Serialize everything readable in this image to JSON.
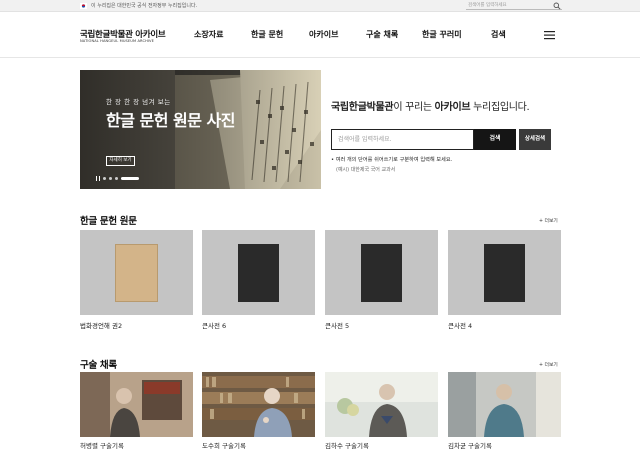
{
  "gov": {
    "notice": "이 누리집은 대한민국 공식 전자정부 누리집입니다.",
    "search_placeholder": "검색어를 입력하세요"
  },
  "header": {
    "logo_title": "국립한글박물관 아카이브",
    "logo_sub": "NATIONAL HANGEUL MUSEUM ARCHIVE",
    "nav": [
      "소장자료",
      "한글 문헌",
      "아카이브",
      "구술 채록",
      "한글 꾸러미",
      "검색"
    ]
  },
  "hero": {
    "subtitle": "한 장 한 장 넘겨 보는",
    "title": "한글 문헌 원문 사진",
    "button": "자세히 보기",
    "slide_count": 4,
    "active_slide": 4
  },
  "search": {
    "intro_a": "국립한글박물관",
    "intro_b": "이 꾸리는 ",
    "intro_c": "아카이브",
    "intro_d": " 누리집입니다.",
    "placeholder": "검색어를 입력하세요.",
    "search_button": "검색",
    "detail_button": "상세검색",
    "tip": "• 여러 개의 단어를 쉬어쓰기로 구분하여 입력해 보세요.",
    "example": "(예시) 대한제국 국어 교과서"
  },
  "documents": {
    "title": "한글 문헌 원문",
    "more": "+ 더보기",
    "items": [
      {
        "label": "법화경언해 권2",
        "cover": "#d3b489"
      },
      {
        "label": "큰사전 6",
        "cover": "#2a2a2a"
      },
      {
        "label": "큰사전 5",
        "cover": "#2a2a2a"
      },
      {
        "label": "큰사전 4",
        "cover": "#2a2a2a"
      }
    ]
  },
  "oral": {
    "title": "구술 채록",
    "more": "+ 더보기",
    "items": [
      {
        "label": "허병렬 구술기록"
      },
      {
        "label": "도수희 구술기록"
      },
      {
        "label": "김하수 구술기록"
      },
      {
        "label": "김차균 구술기록"
      }
    ]
  },
  "colors": {
    "accent_dark": "#151515",
    "card_bg": "#c4c4c4"
  }
}
